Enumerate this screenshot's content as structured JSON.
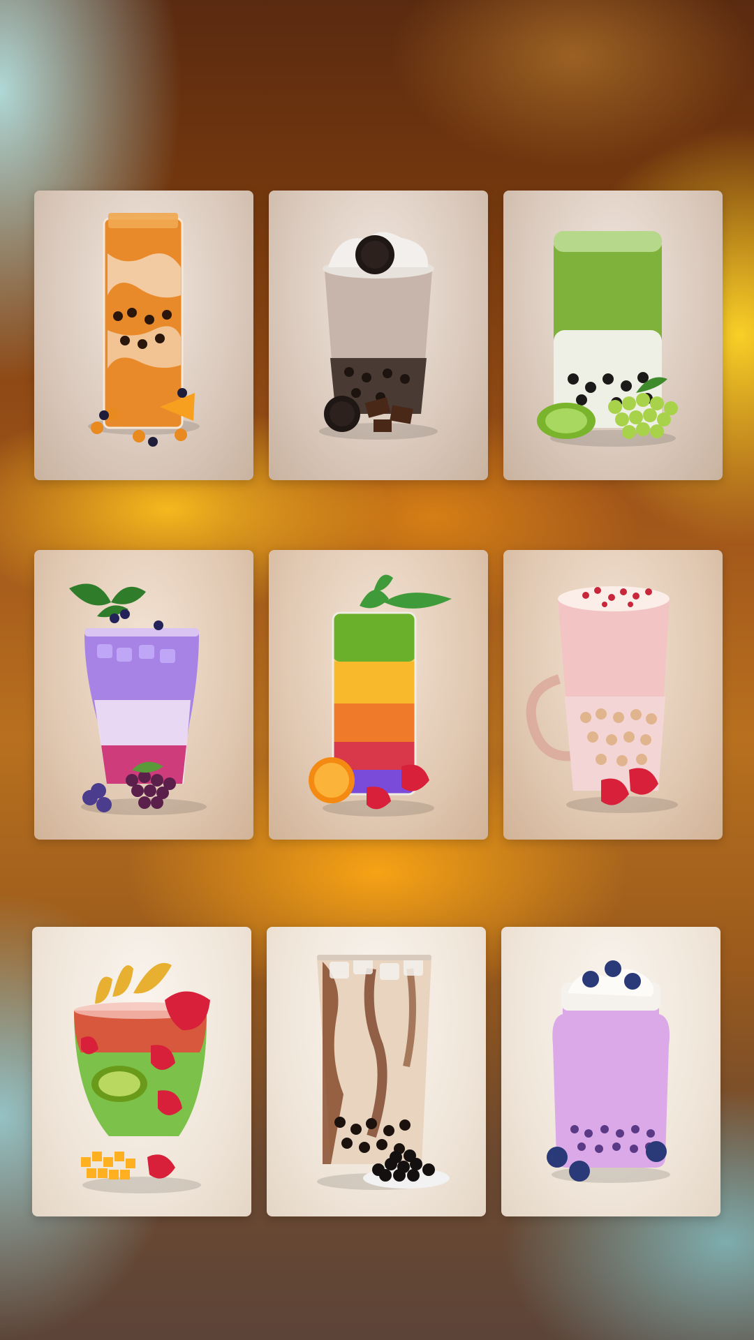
{
  "gallery": {
    "layout": "3x3 grid",
    "tiles": [
      {
        "icon": "orange-boba-tea-icon",
        "color": "#e8892a"
      },
      {
        "icon": "oreo-milk-tea-icon",
        "color": "#b9a79e"
      },
      {
        "icon": "matcha-boba-tea-icon",
        "color": "#7fb23a"
      },
      {
        "icon": "grape-blueberry-soda-icon",
        "color": "#9a7ae0"
      },
      {
        "icon": "rainbow-fruit-mojito-icon",
        "color": "#f2b23a"
      },
      {
        "icon": "strawberry-milk-tea-icon",
        "color": "#f0c2c2"
      },
      {
        "icon": "fruit-punch-icon",
        "color": "#8ac84a"
      },
      {
        "icon": "brown-sugar-boba-milk-icon",
        "color": "#d8b89a"
      },
      {
        "icon": "taro-blueberry-milk-icon",
        "color": "#d8a8e8"
      }
    ]
  }
}
